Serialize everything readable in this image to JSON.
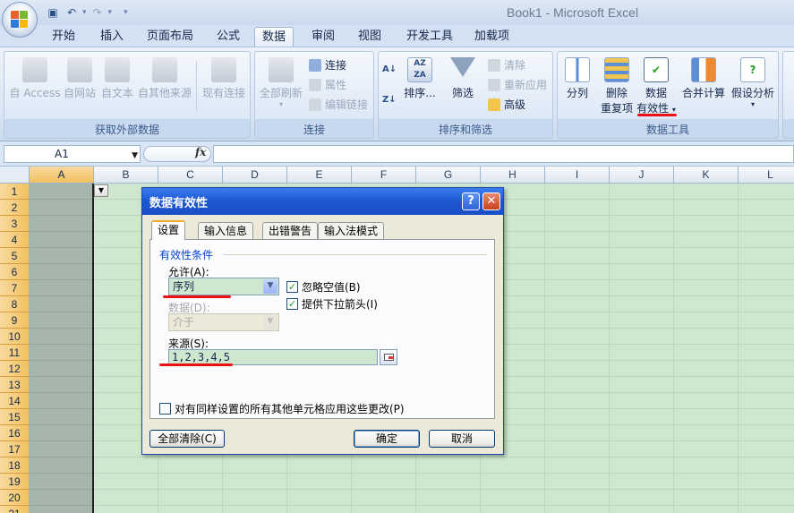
{
  "window": {
    "title": "Book1 - Microsoft Excel"
  },
  "tabs": [
    "开始",
    "插入",
    "页面布局",
    "公式",
    "数据",
    "审阅",
    "视图",
    "开发工具",
    "加载项"
  ],
  "active_tab": "数据",
  "ribbon": {
    "get_external": {
      "label": "获取外部数据",
      "buttons": [
        "自 Access",
        "自网站",
        "自文本",
        "自其他来源",
        "现有连接"
      ]
    },
    "connections": {
      "label": "连接",
      "refresh_all": "全部刷新",
      "connect": "连接",
      "properties": "属性",
      "edit_links": "编辑链接"
    },
    "sort_filter": {
      "label": "排序和筛选",
      "sort": "排序...",
      "filter": "筛选",
      "clear": "清除",
      "reapply": "重新应用",
      "advanced": "高级"
    },
    "data_tools": {
      "label": "数据工具",
      "split": "分列",
      "remove_dup_1": "删除",
      "remove_dup_2": "重复项",
      "validation_1": "数据",
      "validation_2": "有效性",
      "consolidate": "合并计算",
      "whatif": "假设分析"
    }
  },
  "formula_bar": {
    "name_box": "A1",
    "fx": "fx"
  },
  "grid": {
    "columns": [
      "A",
      "B",
      "C",
      "D",
      "E",
      "F",
      "G",
      "H",
      "I",
      "J",
      "K",
      "L"
    ],
    "rows": [
      "1",
      "2",
      "3",
      "4",
      "5",
      "6",
      "7",
      "8",
      "9",
      "10",
      "11",
      "12",
      "13",
      "14",
      "15",
      "16",
      "17",
      "18",
      "19",
      "20",
      "21"
    ]
  },
  "dialog": {
    "title": "数据有效性",
    "tabs": [
      "设置",
      "输入信息",
      "出错警告",
      "输入法模式"
    ],
    "active_tab": "设置",
    "section": "有效性条件",
    "allow_label": "允许(A):",
    "allow_value": "序列",
    "data_label": "数据(D):",
    "data_value": "介于",
    "ignore_blank": "忽略空值(B)",
    "dropdown_arrow": "提供下拉箭头(I)",
    "source_label": "来源(S):",
    "source_value": "1,2,3,4,5",
    "apply_all": "对有同样设置的所有其他单元格应用这些更改(P)",
    "clear_all": "全部清除(C)",
    "ok": "确定",
    "cancel": "取消"
  }
}
